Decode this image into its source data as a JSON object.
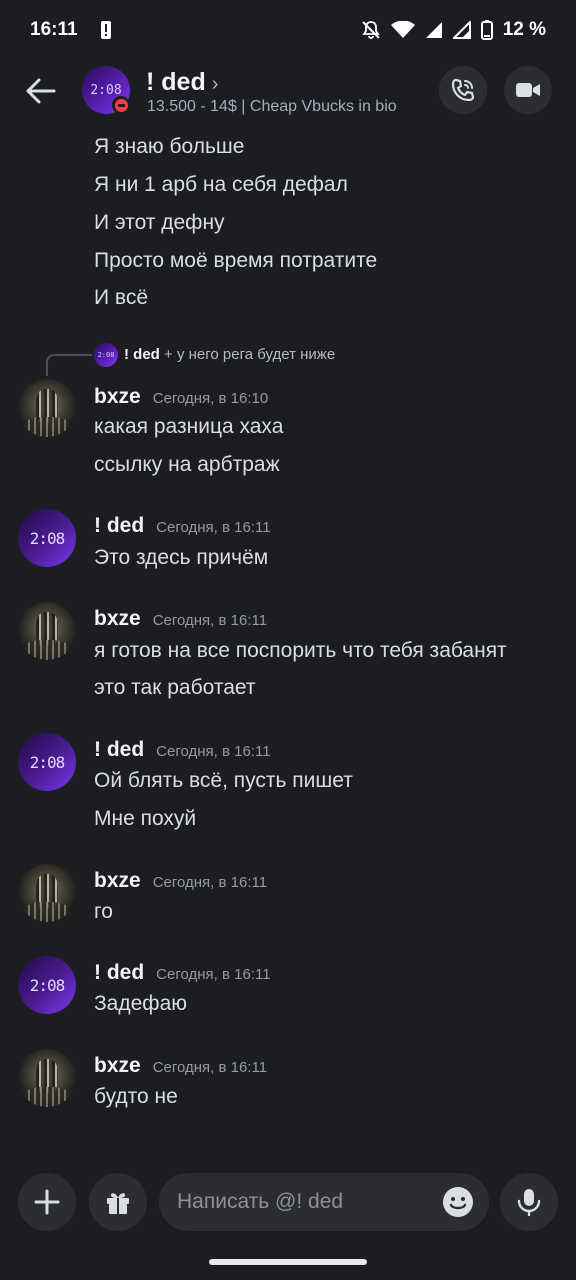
{
  "status_bar": {
    "time": "16:11",
    "battery": "12 %"
  },
  "header": {
    "avatar_text": "2:08",
    "name": "! ded",
    "chevron": "›",
    "status": "13.500 - 14$ | Cheap Vbucks in bio"
  },
  "top_lines": [
    "Я знаю больше",
    "Я ни 1 арб на себя дефал",
    "И этот дефну",
    "Просто моё время потратите",
    "И всё"
  ],
  "reply": {
    "author": "! ded",
    "text": "+ у него рега будет ниже",
    "avatar_text": "2:08"
  },
  "messages": [
    {
      "author": "bxze",
      "time": "Сегодня, в 16:10",
      "lines": [
        "какая разница хаха",
        "ссылку на арбтраж"
      ]
    },
    {
      "author": "! ded",
      "time": "Сегодня, в 16:11",
      "lines": [
        "Это здесь причём"
      ]
    },
    {
      "author": "bxze",
      "time": "Сегодня, в 16:11",
      "lines": [
        "я готов на все поспорить что тебя забанят",
        "это так работает"
      ]
    },
    {
      "author": "! ded",
      "time": "Сегодня, в 16:11",
      "lines": [
        "Ой блять всё, пусть пишет",
        "Мне похуй"
      ]
    },
    {
      "author": "bxze",
      "time": "Сегодня, в 16:11",
      "lines": [
        "го"
      ]
    },
    {
      "author": "! ded",
      "time": "Сегодня, в 16:11",
      "lines": [
        "Задефаю"
      ]
    },
    {
      "author": "bxze",
      "time": "Сегодня, в 16:11",
      "lines": [
        "будто не"
      ]
    }
  ],
  "avatar_text": "2:08",
  "composer": {
    "placeholder": "Написать @! ded"
  },
  "colors": {
    "background": "#1c1d22",
    "button_bg": "#2b2d31",
    "dnd_red": "#f23f43",
    "avatar_purple": "#5b21b6"
  },
  "icons": [
    "back-arrow-icon",
    "call-icon",
    "video-icon",
    "plus-icon",
    "gift-icon",
    "emoji-icon",
    "mic-icon",
    "dnd-icon",
    "wifi-icon",
    "signal-icon",
    "battery-icon",
    "mute-bell-icon",
    "alert-icon"
  ]
}
